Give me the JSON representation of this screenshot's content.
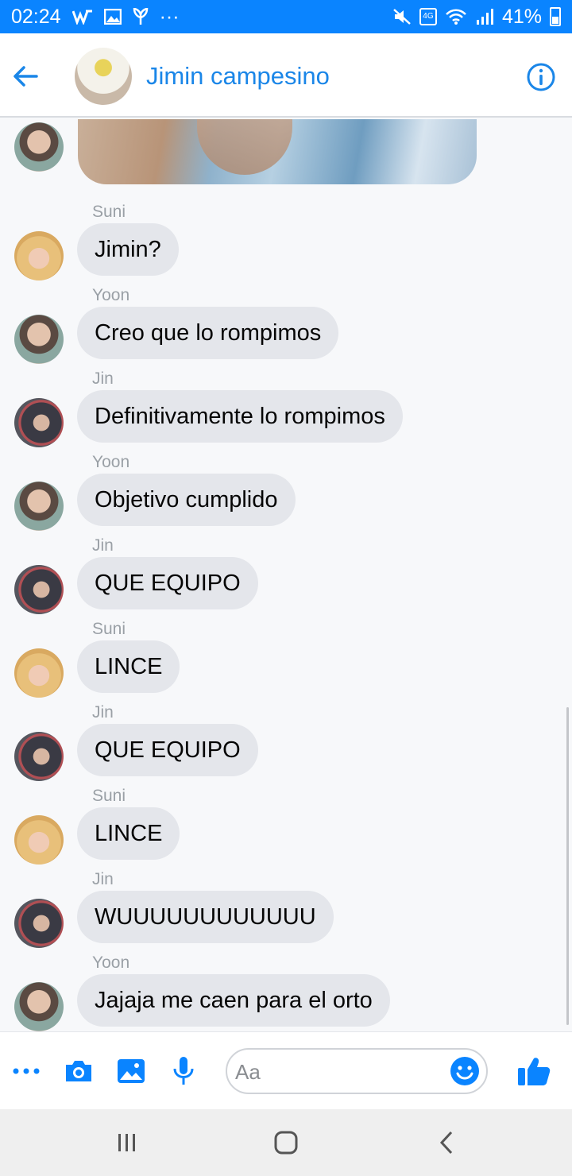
{
  "status_bar": {
    "time": "02:24",
    "dots": "···",
    "battery_percent": "41%",
    "network_label": "4G",
    "left_icons": [
      "wordpress-icon",
      "gallery-icon",
      "plant-icon"
    ],
    "right_icons": [
      "mute-icon",
      "volte-icon",
      "wifi-icon",
      "signal-icon",
      "battery-icon"
    ]
  },
  "header": {
    "title": "Jimin campesino"
  },
  "messages": [
    {
      "sender": "Suni",
      "text": "Jimin?",
      "avatar": "suni"
    },
    {
      "sender": "Yoon",
      "text": "Creo que lo rompimos",
      "avatar": "yoon"
    },
    {
      "sender": "Jin",
      "text": "Definitivamente lo rompimos",
      "avatar": "jin"
    },
    {
      "sender": "Yoon",
      "text": "Objetivo cumplido",
      "avatar": "yoon"
    },
    {
      "sender": "Jin",
      "text": "QUE EQUIPO",
      "avatar": "jin"
    },
    {
      "sender": "Suni",
      "text": "LINCE",
      "avatar": "suni"
    },
    {
      "sender": "Jin",
      "text": "QUE EQUIPO",
      "avatar": "jin"
    },
    {
      "sender": "Suni",
      "text": "LINCE",
      "avatar": "suni"
    },
    {
      "sender": "Jin",
      "text": "WUUUUUUUUUUUU",
      "avatar": "jin"
    },
    {
      "sender": "Yoon",
      "text": "Jajaja me caen para el orto",
      "avatar": "yoon"
    }
  ],
  "composer": {
    "placeholder": "Aa",
    "icons": [
      "more-icon",
      "camera-icon",
      "image-icon",
      "microphone-icon",
      "emoji-icon",
      "like-icon"
    ]
  },
  "colors": {
    "accent": "#0a84ff",
    "title": "#1a86e8",
    "bubble": "#e4e6eb"
  }
}
